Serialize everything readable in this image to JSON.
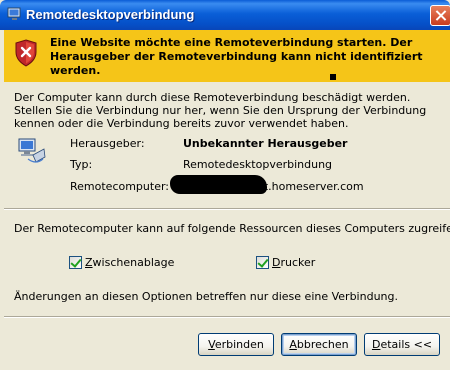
{
  "window": {
    "title": "Remotedesktopverbindung"
  },
  "warning": {
    "text": "Eine Website möchte eine Remoteverbindung starten. Der Herausgeber der Remoteverbindung kann nicht identifiziert werden."
  },
  "intro": "Der Computer kann durch diese Remoteverbindung beschädigt werden. Stellen Sie die Verbindung nur her, wenn Sie den Ursprung der Verbindung kennen oder die Verbindung bereits zuvor verwendet haben.",
  "info": {
    "publisher_label": "Herausgeber:",
    "publisher_value": "Unbekannter Herausgeber",
    "type_label": "Typ:",
    "type_value": "Remotedesktopverbindung",
    "computer_label": "Remotecomputer:",
    "computer_value_visible": "eit.homeserver.com"
  },
  "resources": {
    "note": "Der Remotecomputer kann auf folgende Ressourcen dieses Computers zugreifen:",
    "clipboard": {
      "accel": "Z",
      "rest": "wischenablage",
      "checked": true
    },
    "printer": {
      "accel": "D",
      "rest": "rucker",
      "checked": true
    }
  },
  "change_note": "Änderungen an diesen Optionen betreffen nur diese eine Verbindung.",
  "buttons": {
    "connect": {
      "accel": "V",
      "rest": "erbinden"
    },
    "cancel": {
      "accel": "A",
      "rest": "bbrechen"
    },
    "details": {
      "accel": "D",
      "rest": "etails <<"
    }
  },
  "colors": {
    "titlebar": "#0a5fd8",
    "banner": "#f5c518",
    "dialog": "#ece9d8"
  }
}
